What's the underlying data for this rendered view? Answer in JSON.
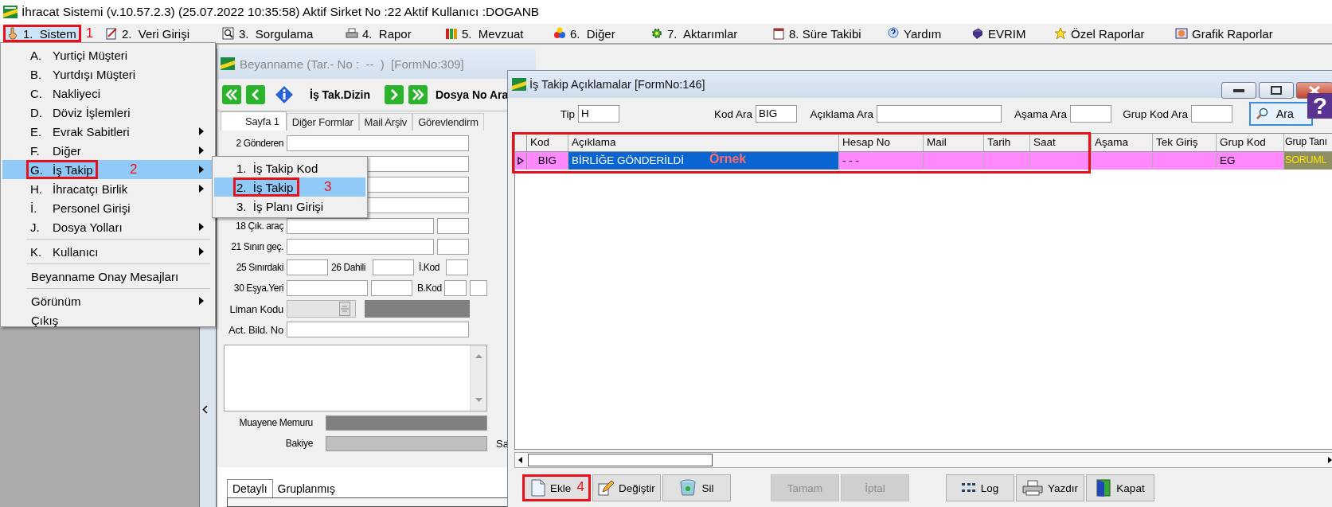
{
  "window": {
    "title": "İhracat Sistemi (v.10.57.2.3) (25.07.2022 10:35:58) Aktif Sirket No :22 Aktif Kullanıcı :DOGANB"
  },
  "menu_bar": [
    {
      "label": "1.  Sistem",
      "selected": true,
      "marker": "1"
    },
    {
      "label": "2.  Veri Girişi",
      "selected": false
    },
    {
      "label": "3.  Sorgulama",
      "selected": false
    },
    {
      "label": "4.  Rapor",
      "selected": false
    },
    {
      "label": "5.  Mevzuat",
      "selected": false
    },
    {
      "label": "6.  Diğer",
      "selected": false
    },
    {
      "label": "7.  Aktarımlar",
      "selected": false
    },
    {
      "label": "8. Süre Takibi",
      "selected": false
    },
    {
      "label": "Yardım",
      "selected": false
    },
    {
      "label": "EVRIM",
      "selected": false
    },
    {
      "label": "Özel Raporlar",
      "selected": false
    },
    {
      "label": "Grafik Raporlar",
      "selected": false
    }
  ],
  "dropdown": [
    {
      "key": "A.",
      "label": "Yurtiçi Müşteri",
      "submenu": false,
      "selected": false,
      "separator_before": false
    },
    {
      "key": "B.",
      "label": "Yurtdışı Müşteri",
      "submenu": false,
      "selected": false,
      "separator_before": false
    },
    {
      "key": "C.",
      "label": "Nakliyeci",
      "submenu": false,
      "selected": false,
      "separator_before": false
    },
    {
      "key": "D.",
      "label": "Döviz İşlemleri",
      "submenu": false,
      "selected": false,
      "separator_before": false
    },
    {
      "key": "E.",
      "label": "Evrak Sabitleri",
      "submenu": true,
      "selected": false,
      "separator_before": false
    },
    {
      "key": "F.",
      "label": "Diğer",
      "submenu": true,
      "selected": false,
      "separator_before": false
    },
    {
      "key": "G.",
      "label": "İş Takip",
      "submenu": true,
      "selected": true,
      "separator_before": false,
      "marker": "2"
    },
    {
      "key": "H.",
      "label": "İhracatçı Birlik",
      "submenu": true,
      "selected": false,
      "separator_before": false
    },
    {
      "key": "İ.",
      "label": "Personel Girişi",
      "submenu": false,
      "selected": false,
      "separator_before": false
    },
    {
      "key": "J.",
      "label": "Dosya Yolları",
      "submenu": true,
      "selected": false,
      "separator_before": false
    },
    {
      "key": "K.",
      "label": "Kullanıcı",
      "submenu": true,
      "selected": false,
      "separator_before": true
    },
    {
      "label": "Beyanname Onay Mesajları",
      "submenu": false,
      "selected": false,
      "separator_before": true
    },
    {
      "label": "Görünüm",
      "submenu": true,
      "selected": false,
      "separator_before": true
    },
    {
      "label": "Çıkış",
      "submenu": false,
      "selected": false,
      "separator_before": false
    }
  ],
  "submenu": [
    {
      "label": "1.  İş Takip Kod",
      "selected": false
    },
    {
      "label": "2.  İş Takip",
      "selected": true,
      "marker": "3"
    },
    {
      "label": "3.  İş Planı Girişi",
      "selected": false
    }
  ],
  "beyanname": {
    "title": "Beyanname (Tar.- No :  --  )  [FormNo:309]",
    "toolbar": {
      "dizin_label": "İş Tak.Dizin",
      "search_label": "Dosya No Ara"
    },
    "tabs": [
      {
        "label": "Sayfa 1",
        "selected": true
      },
      {
        "label": "Diğer Formlar",
        "selected": false
      },
      {
        "label": "Mail Arşiv",
        "selected": false
      },
      {
        "label": "Görevlendirm",
        "selected": false
      }
    ],
    "labels": {
      "gonderen": "2 Gönderen",
      "cik_arac": "18 Çık. araç",
      "sinir_gec": "21 Sınırı geç.",
      "sinirdaki": "25 Sınırdaki",
      "dahili": "26 Dahili",
      "i_kod": "İ.Kod",
      "esya_yeri": "30 Eşya.Yeri",
      "b_kod": "B.Kod",
      "liman_kodu": "Liman Kodu",
      "act_bild_no": "Act. Bild. No",
      "muayene_memuru": "Muayene Memuru",
      "bakiye": "Bakiye",
      "cut_label": "Sa"
    },
    "bottom_tabs": [
      {
        "label": "Detaylı",
        "selected": true
      },
      {
        "label": "Gruplanmış",
        "selected": false
      }
    ]
  },
  "dialog": {
    "title": "İş Takip Açıklamalar [FormNo:146]",
    "filters": [
      {
        "label": "Tip",
        "value": "H"
      },
      {
        "label": "Kod Ara",
        "value": "BIG"
      },
      {
        "label": "Açıklama Ara"
      },
      {
        "label": "Aşama Ara"
      },
      {
        "label": "Grup Kod Ara"
      }
    ],
    "search_button": "Ara",
    "help_label": "?",
    "columns": [
      {
        "label": "Kod",
        "focused": false
      },
      {
        "label": "Açıklama",
        "focused": true
      },
      {
        "label": "Hesap No",
        "focused": false
      },
      {
        "label": "Mail",
        "focused": false
      },
      {
        "label": "Tarih",
        "focused": false
      },
      {
        "label": "Saat",
        "focused": false
      },
      {
        "label": "Aşama",
        "focused": false
      },
      {
        "label": "Tek Giriş",
        "focused": false
      },
      {
        "label": "Grup Kod",
        "focused": false
      },
      {
        "label": "Grup Tanı",
        "focused": false
      }
    ],
    "rows": [
      {
        "selected": true,
        "annotation": "Örnek",
        "cells": [
          "BIG",
          "BİRLİĞE GÖNDERİLDİ",
          "- - -",
          null,
          null,
          null,
          null,
          null,
          "EG",
          "SORUML"
        ]
      }
    ],
    "buttons": [
      {
        "label": "Ekle",
        "disabled": false,
        "marker": "4"
      },
      {
        "label": "Değiştir",
        "disabled": false
      },
      {
        "label": "Sil",
        "disabled": false
      },
      {
        "label": "Tamam",
        "disabled": true
      },
      {
        "label": "İptal",
        "disabled": true
      },
      {
        "label": "Log",
        "disabled": false
      },
      {
        "label": "Yazdır",
        "disabled": false
      },
      {
        "label": "Kapat",
        "disabled": false
      }
    ]
  }
}
